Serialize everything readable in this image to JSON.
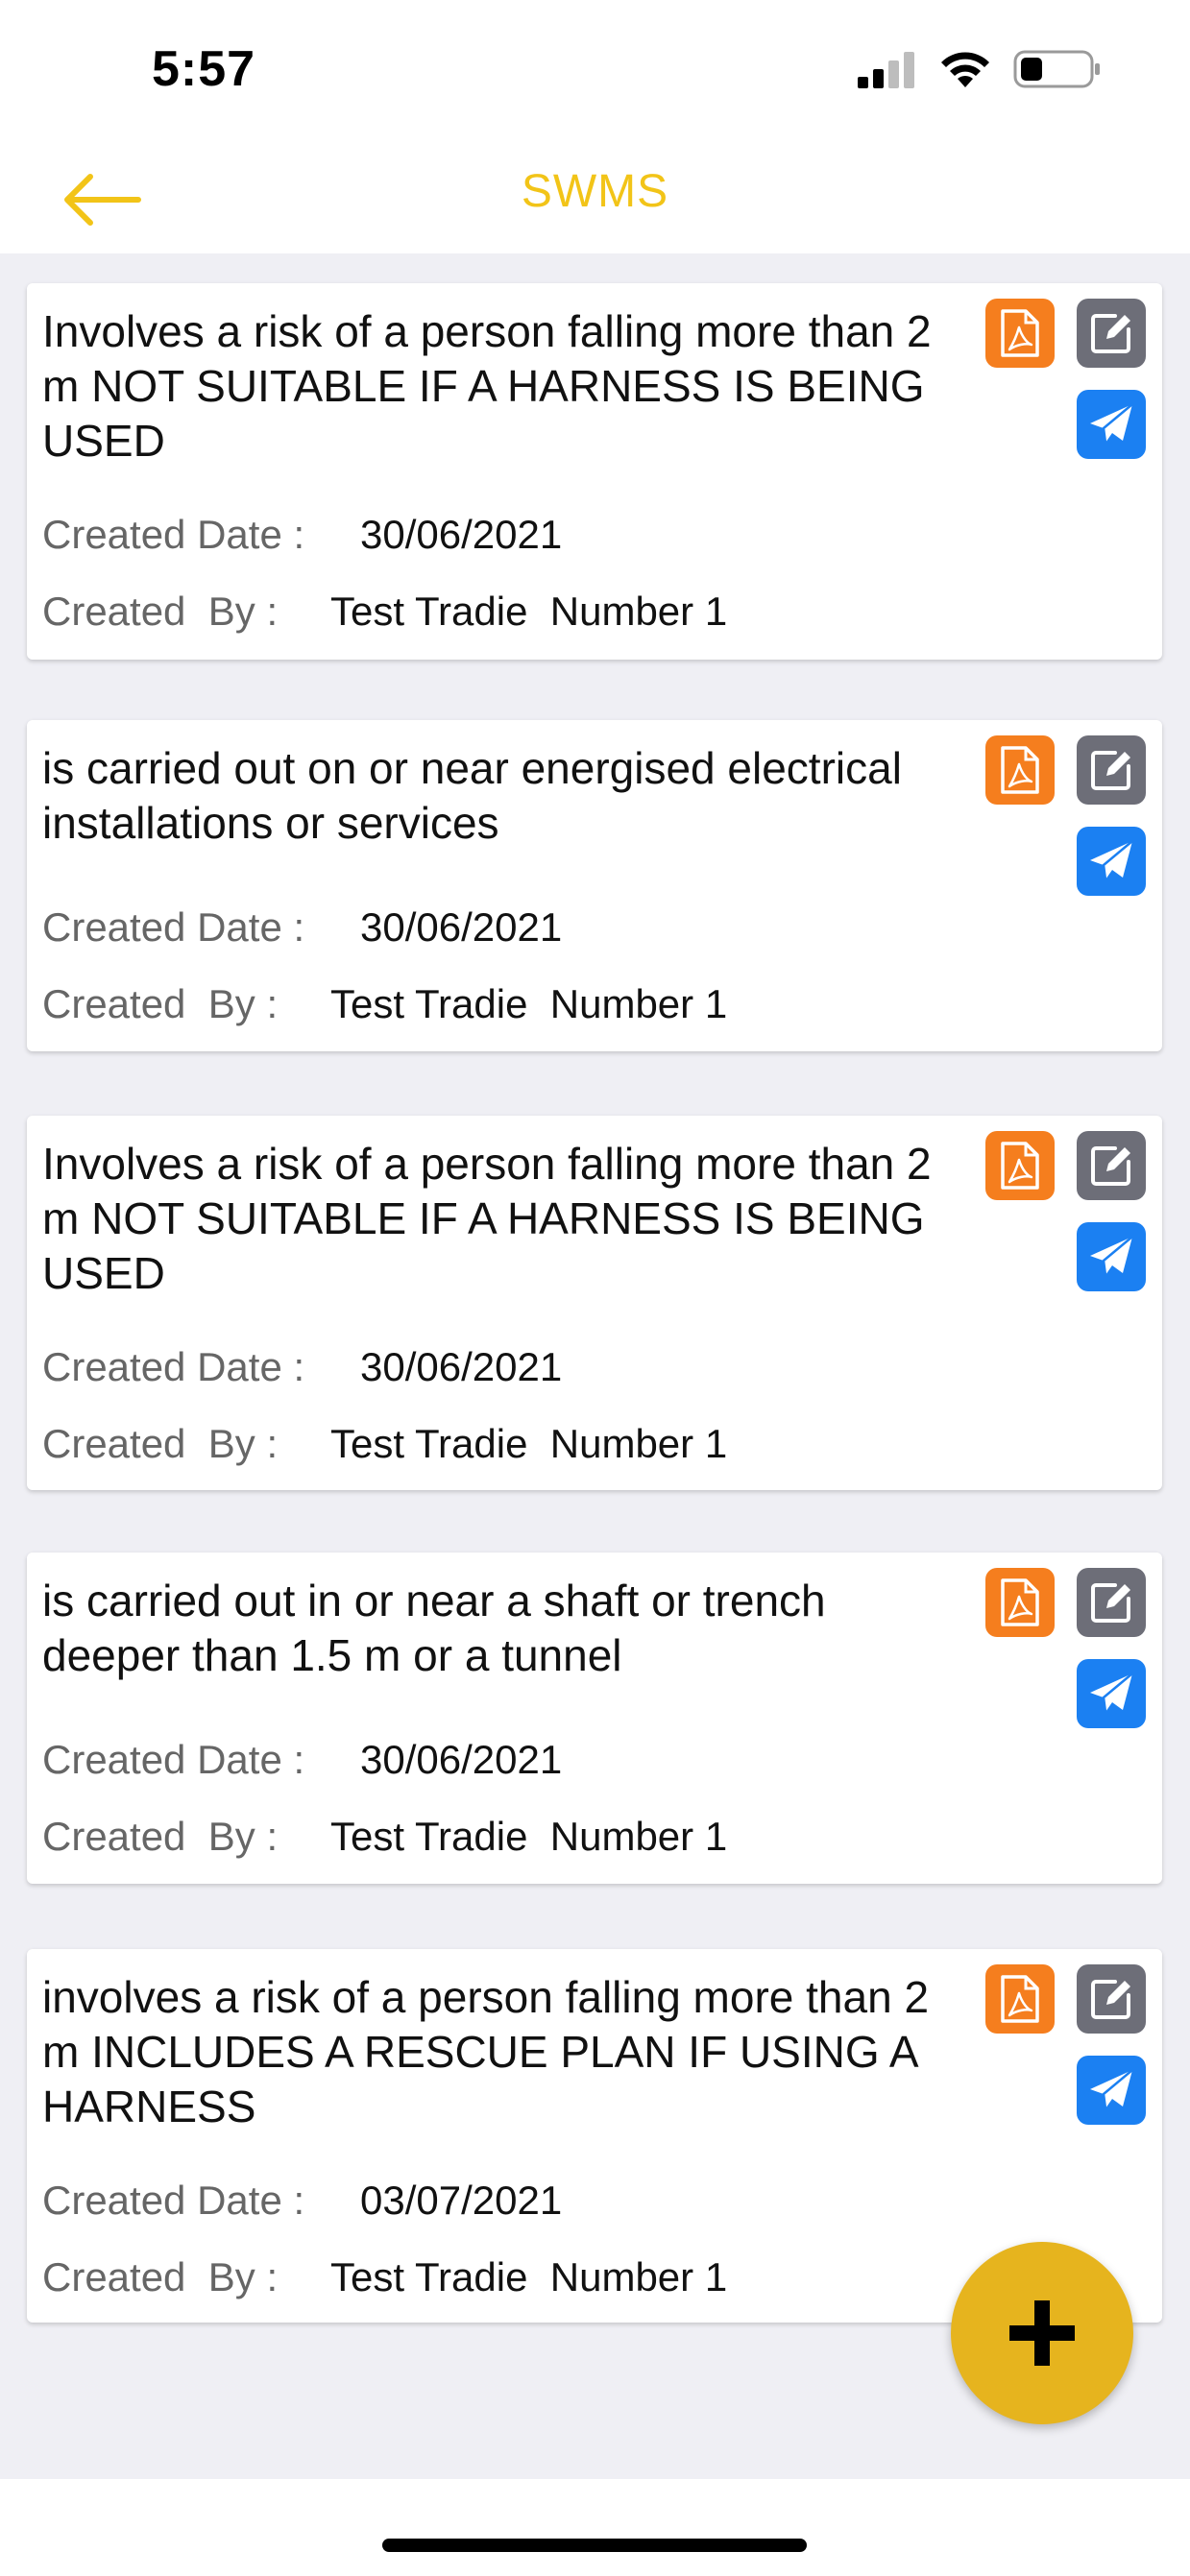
{
  "status_bar": {
    "time": "5:57"
  },
  "header": {
    "title": "SWMS"
  },
  "colors": {
    "accent": "#f2c418",
    "fab": "#e6b41e",
    "pdf": "#f57e1e",
    "edit": "#6d6e78",
    "send": "#1b80f2"
  },
  "icons": {
    "back": "arrow-left-icon",
    "pdf": "pdf-icon",
    "edit": "edit-icon",
    "send": "send-icon",
    "add": "plus-icon"
  },
  "labels": {
    "created_date": "Created Date :",
    "created_by": "Created  By :"
  },
  "items": [
    {
      "title": "Involves a risk of a person falling more than 2 m NOT SUITABLE IF A HARNESS IS BEING USED",
      "created_date": "30/06/2021",
      "created_by": "Test Tradie  Number 1"
    },
    {
      "title": "is carried out on or near energised electrical installations or services",
      "created_date": "30/06/2021",
      "created_by": "Test Tradie  Number 1"
    },
    {
      "title": "Involves a risk of a person falling more than 2 m NOT SUITABLE IF A HARNESS IS BEING USED",
      "created_date": "30/06/2021",
      "created_by": "Test Tradie  Number 1"
    },
    {
      "title": "is carried out in or near a shaft or trench deeper than 1.5 m or a tunnel",
      "created_date": "30/06/2021",
      "created_by": "Test Tradie  Number 1"
    },
    {
      "title": "involves a risk of a person falling more than 2 m INCLUDES A RESCUE PLAN IF USING A HARNESS",
      "created_date": "03/07/2021",
      "created_by": "Test Tradie  Number 1"
    }
  ]
}
